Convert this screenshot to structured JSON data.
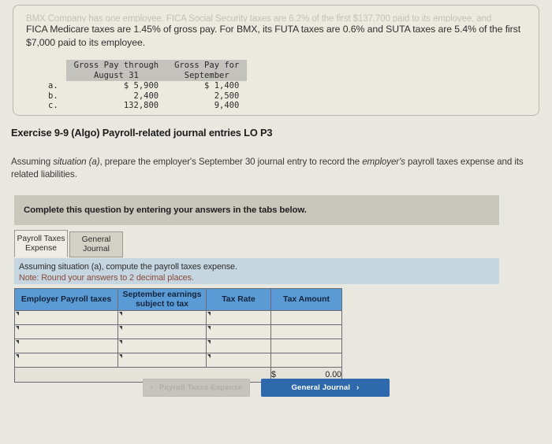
{
  "scenario": {
    "faded_line": "BMX Company has one employee. FICA Social Security taxes are 6.2% of the first $137,700 paid to its employee, and",
    "paragraph": "FICA Medicare taxes are 1.45% of gross pay. For BMX, its FUTA taxes are 0.6% and SUTA taxes are 5.4% of the first $7,000 paid to its employee.",
    "gross_table": {
      "headers": [
        "Gross Pay through\nAugust 31",
        "Gross Pay for\nSeptember"
      ],
      "rows": [
        {
          "label": "a.",
          "through_august": "$ 5,900",
          "september": "$ 1,400"
        },
        {
          "label": "b.",
          "through_august": "2,400",
          "september": "2,500"
        },
        {
          "label": "c.",
          "through_august": "132,800",
          "september": "9,400"
        }
      ]
    }
  },
  "exercise": {
    "title": "Exercise 9-9 (Algo) Payroll-related journal entries LO P3",
    "prompt_part1": "Assuming ",
    "prompt_italic1": "situation (a)",
    "prompt_part2": ", prepare the employer's September 30 journal entry to record the ",
    "prompt_italic2": "employer's",
    "prompt_part3": " payroll taxes expense and its related liabilities."
  },
  "complete_bar": {
    "text": "Complete this question by entering your answers in the tabs below."
  },
  "tabs": [
    {
      "line1": "Payroll Taxes",
      "line2": "Expense",
      "active": true
    },
    {
      "line1": "General",
      "line2": "Journal",
      "active": false
    }
  ],
  "note": {
    "line1": "Assuming situation (a), compute the payroll taxes expense.",
    "line2": "Note: Round your answers to 2 decimal places."
  },
  "answer_table": {
    "headers": [
      "Employer Payroll taxes",
      "September earnings\nsubject to tax",
      "Tax Rate",
      "Tax Amount"
    ],
    "rows": [
      {
        "tax": "",
        "earnings": "",
        "rate": "",
        "amount": ""
      },
      {
        "tax": "",
        "earnings": "",
        "rate": "",
        "amount": ""
      },
      {
        "tax": "",
        "earnings": "",
        "rate": "",
        "amount": ""
      },
      {
        "tax": "",
        "earnings": "",
        "rate": "",
        "amount": ""
      }
    ],
    "total": {
      "currency": "$",
      "value": "0.00"
    }
  },
  "nav": {
    "prev_label": "Payroll Taxes Expense",
    "prev_chevron": "‹",
    "next_label": "General Journal",
    "next_chevron": "›"
  },
  "colors": {
    "table_header_blue": "#5b9bd5",
    "note_blue": "#c5d6e0",
    "next_button_blue": "#2e68ad",
    "note_warning_red": "#8a4a3c",
    "page_bg": "#e8e7e0"
  }
}
